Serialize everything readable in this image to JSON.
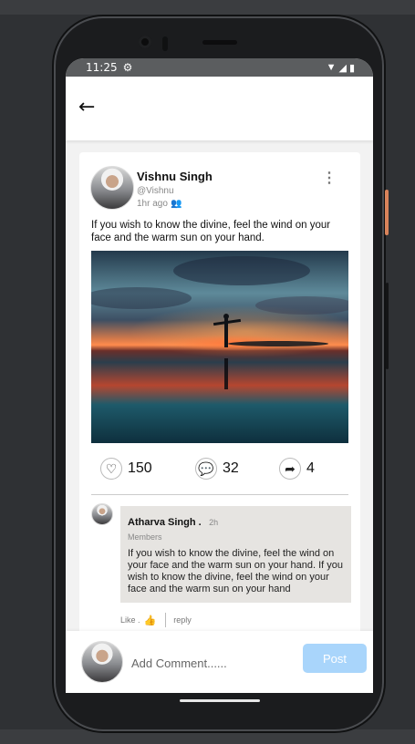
{
  "status_bar": {
    "time": "11:25",
    "icons": [
      "gear-icon",
      "wifi-icon",
      "signal-icon",
      "battery-icon"
    ]
  },
  "app_bar": {
    "back_icon": "arrow-left-icon"
  },
  "post": {
    "author_name": "Vishnu Singh",
    "author_handle": "@Vishnu",
    "time_ago": "1hr ago",
    "text": "If you wish to know the divine, feel the wind on your face and the warm sun on your hand.",
    "likes": "150",
    "comments": "32",
    "shares": "4"
  },
  "comment": {
    "author_name": "Atharva Singh .",
    "time_ago": "2h",
    "role": "Members",
    "text": "If you wish to know the divine, feel the wind on your face and the warm sun on your hand. If you wish to know the divine, feel the wind on your face and the warm sun on your hand",
    "like_label": "Like .",
    "reply_label": "reply"
  },
  "composer": {
    "placeholder": "Add Comment......",
    "post_label": "Post"
  },
  "colors": {
    "post_button": "#a9d5fb",
    "like_thumb": "#2b7fd6",
    "comment_bubble": "#e6e4e1"
  }
}
